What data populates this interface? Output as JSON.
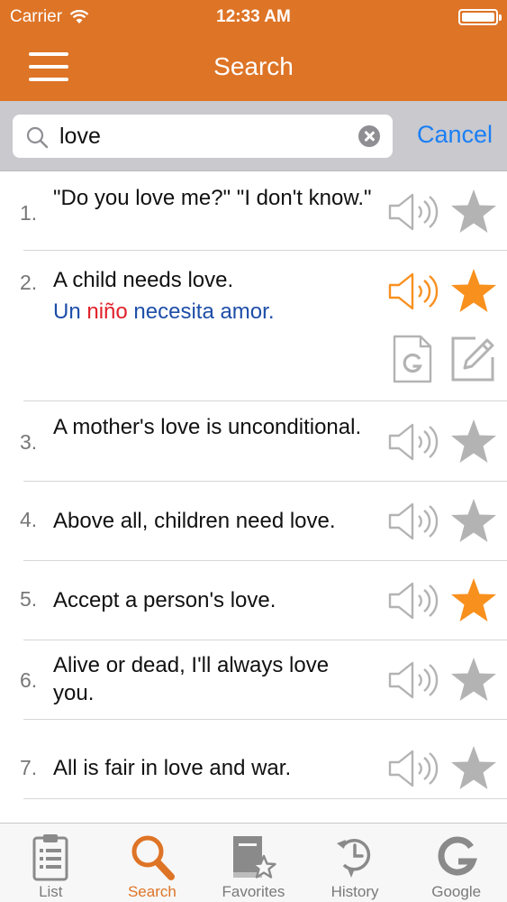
{
  "status_bar": {
    "carrier": "Carrier",
    "time": "12:33 AM"
  },
  "nav": {
    "title": "Search"
  },
  "search": {
    "value": "love",
    "cancel_label": "Cancel"
  },
  "colors": {
    "accent": "#de7426",
    "star_active": "#f8901e",
    "star_inactive": "#b3b3b3",
    "link_blue": "#1b7ff5",
    "translation_blue": "#1e4ea8",
    "translation_red": "#e0212a"
  },
  "results": [
    {
      "num": "1.",
      "text": "\"Do you love me?\" \"I don't know.\"",
      "favorite": false
    },
    {
      "num": "2.",
      "text": "A child needs love.",
      "favorite": true,
      "translation": {
        "part1": "Un ",
        "part2": "niño",
        "part3": " necesita amor."
      }
    },
    {
      "num": "3.",
      "text": "A mother's love is unconditional.",
      "favorite": false
    },
    {
      "num": "4.",
      "text": "Above all, children need love.",
      "favorite": false
    },
    {
      "num": "5.",
      "text": "Accept a person's love.",
      "favorite": true
    },
    {
      "num": "6.",
      "text": "Alive or dead, I'll always love you.",
      "favorite": false
    },
    {
      "num": "7.",
      "text": "All is fair in love and war.",
      "favorite": false
    }
  ],
  "tabs": [
    {
      "label": "List",
      "icon": "clipboard-list-icon"
    },
    {
      "label": "Search",
      "icon": "magnifier-icon",
      "active": true
    },
    {
      "label": "Favorites",
      "icon": "book-star-icon"
    },
    {
      "label": "History",
      "icon": "clock-history-icon"
    },
    {
      "label": "Google",
      "icon": "google-g-icon"
    }
  ]
}
